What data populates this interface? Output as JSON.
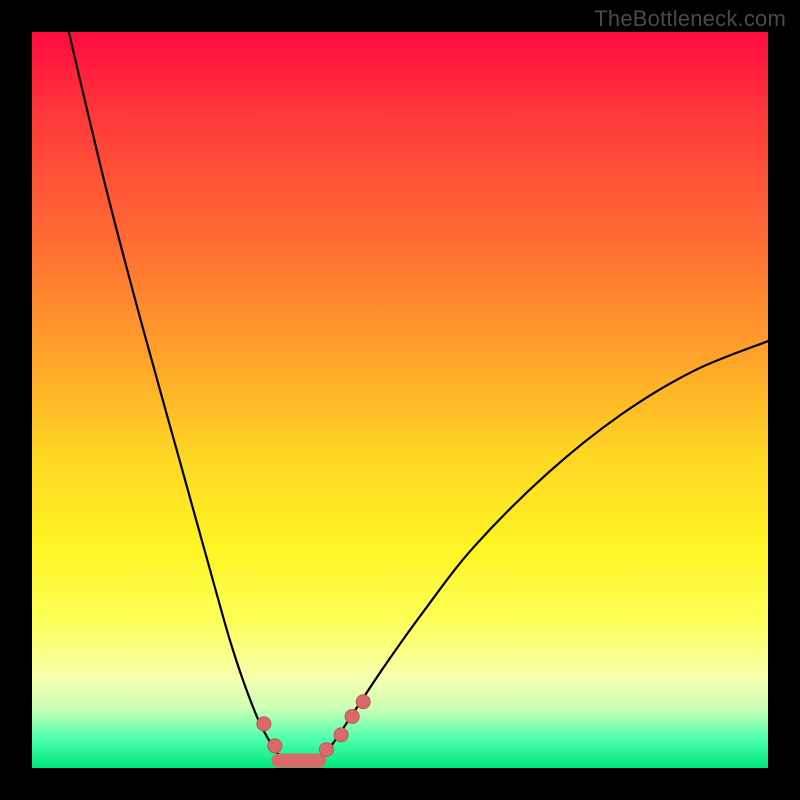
{
  "attribution": "TheBottleneck.com",
  "colors": {
    "frame": "#000000",
    "curve_stroke": "#000000",
    "marker_fill": "#d86a6a",
    "marker_stroke": "#c45555",
    "worm_fill": "#d86a6a"
  },
  "chart_data": {
    "type": "line",
    "title": "",
    "xlabel": "",
    "ylabel": "",
    "xlim": [
      0,
      100
    ],
    "ylim": [
      0,
      100
    ],
    "grid": false,
    "legend": false,
    "annotations": [
      "TheBottleneck.com"
    ],
    "series": [
      {
        "name": "left-branch",
        "x": [
          5,
          10,
          15,
          20,
          25,
          27,
          29,
          31,
          33,
          34.5
        ],
        "y": [
          100,
          79,
          60,
          42,
          24,
          17,
          11,
          6,
          2.5,
          0.8
        ]
      },
      {
        "name": "right-branch",
        "x": [
          39,
          41,
          44,
          48,
          53,
          60,
          70,
          80,
          90,
          100
        ],
        "y": [
          0.8,
          3.5,
          8,
          14,
          21,
          30,
          40,
          48,
          54,
          58
        ]
      }
    ],
    "markers": {
      "name": "highlighted-points",
      "x": [
        31.5,
        33.0,
        40.0,
        42.0,
        43.5,
        45.0
      ],
      "y": [
        6.0,
        3.0,
        2.5,
        4.5,
        7.0,
        9.0
      ]
    },
    "worm_segment": {
      "name": "valley-floor",
      "x": [
        33.5,
        39.0
      ],
      "y": [
        1.0,
        1.0
      ]
    }
  }
}
